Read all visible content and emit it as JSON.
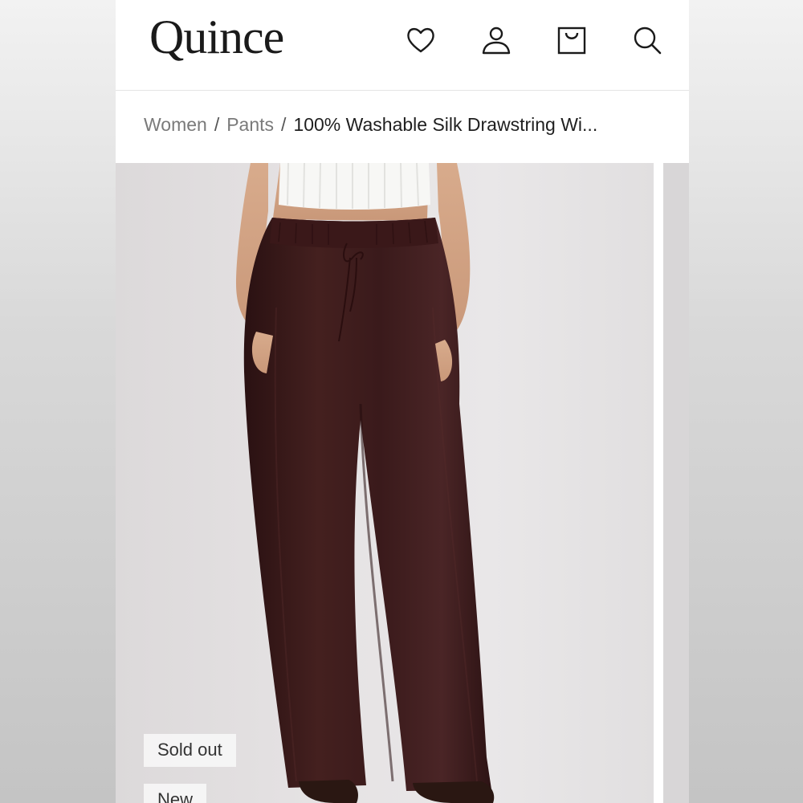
{
  "brand": {
    "logo": "Quince"
  },
  "header": {
    "icons": [
      "heart-icon",
      "user-icon",
      "shopping-bag-icon",
      "search-icon"
    ]
  },
  "breadcrumb": {
    "items": [
      "Women",
      "Pants",
      "100% Washable Silk Drawstring Wi..."
    ],
    "separator": "/"
  },
  "product": {
    "badges": {
      "sold_out": "Sold out",
      "new": "New"
    },
    "pants_color": "#3b1b1c"
  },
  "colors": {
    "text": "#1a1a1a",
    "muted": "#7a7a7a",
    "background": "#ffffff"
  }
}
